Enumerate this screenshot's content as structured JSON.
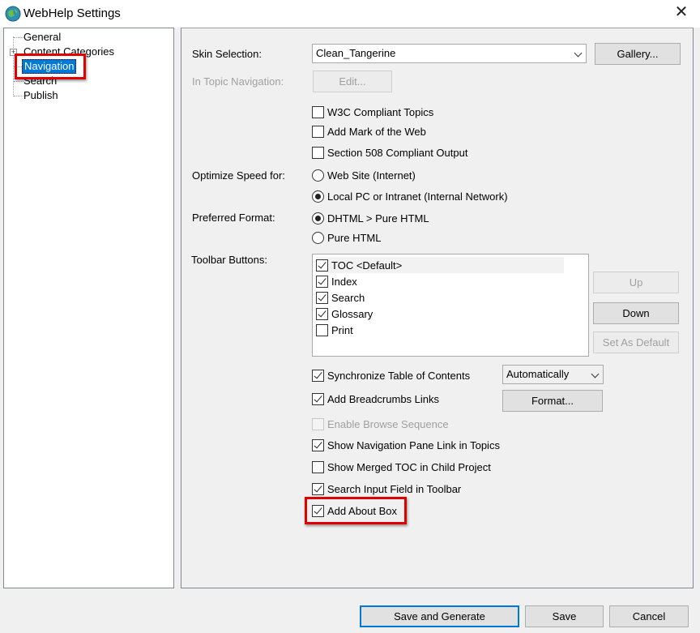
{
  "window": {
    "title": "WebHelp Settings",
    "close_glyph": "✕"
  },
  "tree": {
    "items": [
      {
        "label": "General"
      },
      {
        "label": "Content Categories",
        "expander": "+"
      },
      {
        "label": "Navigation"
      },
      {
        "label": "Search"
      },
      {
        "label": "Publish"
      }
    ]
  },
  "skin": {
    "label": "Skin Selection:",
    "value": "Clean_Tangerine",
    "gallery_button": "Gallery..."
  },
  "in_topic_nav": {
    "label": "In Topic Navigation:",
    "edit_button": "Edit..."
  },
  "options_top": [
    {
      "label": "W3C Compliant Topics",
      "checked": false
    },
    {
      "label": "Add Mark of the Web",
      "checked": false
    },
    {
      "label": "Section 508 Compliant Output",
      "checked": false
    }
  ],
  "optimize": {
    "label": "Optimize Speed for:",
    "options": [
      {
        "label": "Web Site (Internet)",
        "selected": false
      },
      {
        "label": "Local PC or Intranet (Internal Network)",
        "selected": true
      }
    ]
  },
  "format": {
    "label": "Preferred Format:",
    "options": [
      {
        "label": "DHTML > Pure HTML",
        "selected": true
      },
      {
        "label": "Pure HTML",
        "selected": false
      }
    ]
  },
  "toolbar_buttons": {
    "label": "Toolbar Buttons:",
    "items": [
      {
        "label": "TOC <Default>",
        "checked": true
      },
      {
        "label": "Index",
        "checked": true
      },
      {
        "label": "Search",
        "checked": true
      },
      {
        "label": "Glossary",
        "checked": true
      },
      {
        "label": "Print",
        "checked": false
      }
    ],
    "up_button": "Up",
    "down_button": "Down",
    "default_button": "Set As Default"
  },
  "sync_toc": {
    "label": "Synchronize Table of Contents",
    "checked": true,
    "mode": "Automatically"
  },
  "breadcrumbs": {
    "label": "Add Breadcrumbs Links",
    "checked": true,
    "format_button": "Format..."
  },
  "options_bottom": [
    {
      "label": "Enable Browse Sequence",
      "checked": false,
      "disabled": true
    },
    {
      "label": "Show Navigation Pane Link in Topics",
      "checked": true
    },
    {
      "label": "Show Merged TOC in Child Project",
      "checked": false
    },
    {
      "label": "Search Input Field in Toolbar",
      "checked": true
    },
    {
      "label": "Add About Box",
      "checked": true
    }
  ],
  "footer": {
    "save_generate": "Save and Generate",
    "save": "Save",
    "cancel": "Cancel"
  },
  "colors": {
    "highlight": "#e00000",
    "selection": "#0078d7"
  }
}
